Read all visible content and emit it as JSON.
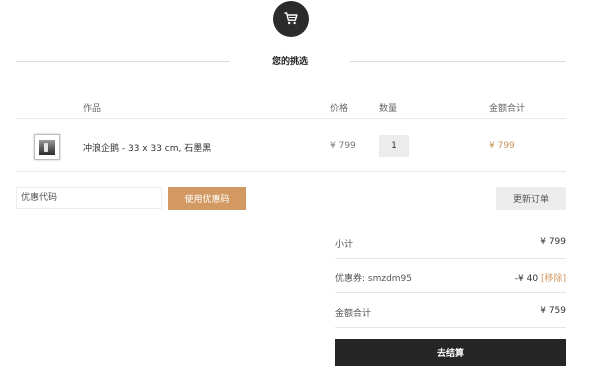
{
  "cart_icon": "shopping-cart-icon",
  "section_title": "您的挑选",
  "table": {
    "headers": {
      "product": "作品",
      "price": "价格",
      "quantity": "数量",
      "total": "金额合计"
    },
    "items": [
      {
        "name": "冲浪企鹅 - 33 x 33 cm, 石墨黑",
        "price": "¥ 799",
        "quantity": "1",
        "total": "¥ 799"
      }
    ]
  },
  "coupon": {
    "placeholder": "优惠代码",
    "apply_label": "使用优惠码"
  },
  "update_label": "更新订单",
  "summary": {
    "subtotal_label": "小计",
    "subtotal_value": "¥ 799",
    "discount_label": "优惠券: smzdm95",
    "discount_value": "-¥ 40",
    "remove_label": "[移除]",
    "total_label": "金额合计",
    "total_value": "¥ 759"
  },
  "checkout_label": "去结算",
  "colors": {
    "accent": "#d29a62",
    "price_accent": "#c8925a",
    "dark": "#262626"
  }
}
